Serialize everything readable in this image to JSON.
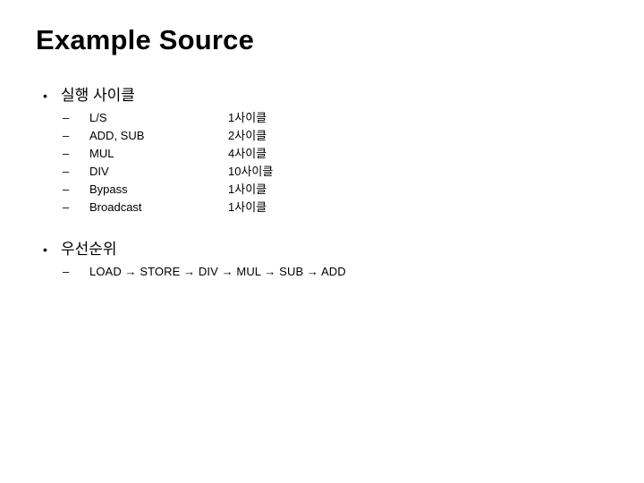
{
  "slide": {
    "title": "Example Source",
    "sections": [
      {
        "heading": "실행 사이클",
        "bullet_marker": "•",
        "dash_marker": "–",
        "items": [
          {
            "label": "L/S",
            "value": "1사이클"
          },
          {
            "label": "ADD, SUB",
            "value": "2사이클"
          },
          {
            "label": "MUL",
            "value": "4사이클"
          },
          {
            "label": "DIV",
            "value": "10사이클"
          },
          {
            "label": "Bypass",
            "value": "1사이클"
          },
          {
            "label": "Broadcast",
            "value": "1사이클"
          }
        ]
      },
      {
        "heading": "우선순위",
        "bullet_marker": "•",
        "dash_marker": "–",
        "chain": "LOAD → STORE → DIV → MUL → SUB → ADD"
      }
    ],
    "colors": {
      "background": "#ffffff",
      "text": "#000000"
    }
  }
}
